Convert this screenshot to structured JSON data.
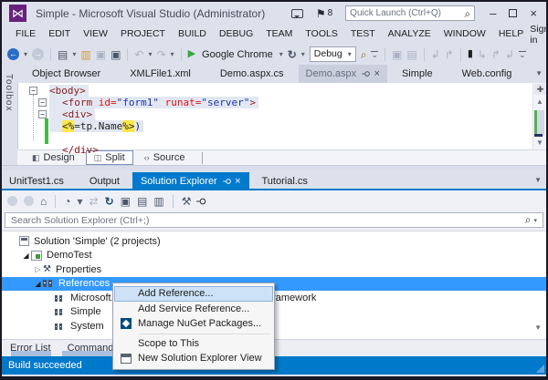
{
  "window": {
    "title": "Simple - Microsoft Visual Studio (Administrator)",
    "badge_count": "8",
    "quick_launch_placeholder": "Quick Launch (Ctrl+Q)"
  },
  "menu_bar": {
    "items": [
      "FILE",
      "EDIT",
      "VIEW",
      "PROJECT",
      "BUILD",
      "DEBUG",
      "TEAM",
      "TOOLS",
      "TEST",
      "ANALYZE",
      "WINDOW",
      "HELP"
    ],
    "sign_in_label": "Sign in"
  },
  "toolbar": {
    "browser_label": "Google Chrome",
    "config_label": "Debug"
  },
  "doc_tabs": {
    "items": [
      {
        "label": "Object Browser"
      },
      {
        "label": "XMLFile1.xml"
      },
      {
        "label": "Demo.aspx.cs"
      },
      {
        "label": "Demo.aspx",
        "active": true,
        "pinned": true,
        "closable": true
      },
      {
        "label": "Simple"
      },
      {
        "label": "Web.config"
      }
    ]
  },
  "toolbox_label": "Toolbox",
  "editor": {
    "lines": [
      {
        "box": true,
        "indent": 0,
        "bg": true,
        "tokens": [
          {
            "c": "tag",
            "t": "<body>"
          }
        ]
      },
      {
        "box": true,
        "indent": 1,
        "bg": true,
        "tokens": [
          {
            "c": "tag",
            "t": "<form"
          },
          {
            "c": "attr",
            "t": " id="
          },
          {
            "c": "val",
            "t": "\"form1\""
          },
          {
            "c": "attr",
            "t": " runat="
          },
          {
            "c": "val",
            "t": "\"server\""
          },
          {
            "c": "tag",
            "t": ">"
          }
        ]
      },
      {
        "box": true,
        "indent": 1,
        "bg": true,
        "tokens": [
          {
            "c": "tag",
            "t": "<div>"
          }
        ]
      },
      {
        "box": false,
        "indent": 1,
        "bg": true,
        "tokens": [
          {
            "c": "hl",
            "t": "<%"
          },
          {
            "c": "plain",
            "t": "=tp.Name"
          },
          {
            "c": "hl",
            "t": "%>"
          },
          {
            "c": "plain",
            "t": ")"
          }
        ]
      },
      {
        "box": false,
        "indent": 1,
        "bg": false,
        "tokens": []
      },
      {
        "box": false,
        "indent": 1,
        "bg": false,
        "tokens": [
          {
            "c": "tag",
            "t": "</div>"
          }
        ]
      }
    ],
    "views": [
      {
        "label": "Design",
        "icon": "design-view-icon"
      },
      {
        "label": "Split",
        "icon": "split-view-icon",
        "active": true
      },
      {
        "label": "Source",
        "icon": "source-view-icon"
      }
    ]
  },
  "panel_tabs": {
    "items": [
      {
        "label": "UnitTest1.cs"
      },
      {
        "label": "Output"
      },
      {
        "label": "Solution Explorer",
        "active": true,
        "pinned": true,
        "closable": true
      },
      {
        "label": "Tutorial.cs"
      }
    ]
  },
  "solution_explorer": {
    "search_placeholder": "Search Solution Explorer (Ctrl+;)",
    "tree": [
      {
        "level": 0,
        "arrow": null,
        "icon": "solution",
        "label": "Solution 'Simple' (2 projects)"
      },
      {
        "level": 1,
        "arrow": "expanded",
        "icon": "project",
        "label": "DemoTest"
      },
      {
        "level": 2,
        "arrow": "collapsed",
        "icon": "properties",
        "label": "Properties"
      },
      {
        "level": 2,
        "arrow": "expanded",
        "icon": "references",
        "label": "References",
        "selected": true
      },
      {
        "level": 3,
        "arrow": null,
        "icon": "reference",
        "label": "Microsoft.VisualStudio.QualityTools.UnitTestFramework"
      },
      {
        "level": 3,
        "arrow": null,
        "icon": "reference",
        "label": "Simple"
      },
      {
        "level": 3,
        "arrow": null,
        "icon": "reference",
        "label": "System"
      }
    ]
  },
  "context_menu": {
    "items": [
      {
        "label": "Add Reference...",
        "highlighted": true
      },
      {
        "label": "Add Service Reference..."
      },
      {
        "label": "Manage NuGet Packages...",
        "icon": "nuget"
      },
      {
        "separator": true
      },
      {
        "label": "Scope to This"
      },
      {
        "label": "New Solution Explorer View",
        "icon": "new-view"
      }
    ]
  },
  "bottom_tabs": {
    "items": [
      "Error List",
      "Command Win"
    ]
  },
  "status_bar": {
    "text": "Build succeeded"
  },
  "icons": {
    "vs_logo": "⋈",
    "flag": "⚑",
    "search": "⌕",
    "minimize": "–",
    "close": "×",
    "dropdown": "▾",
    "overflow": "⌄",
    "back": "←",
    "forward": "→",
    "play": "▶",
    "refresh": "↻",
    "undo": "↶",
    "redo": "↷",
    "home": "⌂",
    "clock": "◔",
    "sync": "⇄",
    "wrench": "⚒",
    "pin": "⚲",
    "bookmark": "▮",
    "scroll_up": "▲",
    "scroll_down": "▼",
    "tree_expanded": "◢",
    "tree_collapsed": "▷",
    "doc": "▤",
    "doc2": "▥",
    "win": "▣",
    "nav1": "↱",
    "nav2": "↳",
    "nav3": "↲",
    "splitter": "✚"
  },
  "colors": {
    "accent_blue": "#007acc",
    "selection_blue": "#3399ff",
    "status_blue": "#0079cb",
    "chrome_bg": "#dce1ec",
    "highlight_yellow": "#fde74c"
  }
}
